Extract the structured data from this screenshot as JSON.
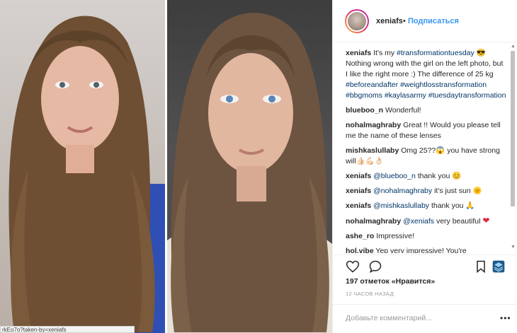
{
  "post": {
    "owner": "xeniafs",
    "dot": "•",
    "follow_label": "Подписаться"
  },
  "status_bar": {
    "text": "rkEo7o?taken-by=xeniafs"
  },
  "comments": [
    {
      "user": "xeniafs",
      "parts": [
        {
          "t": "It's my "
        },
        {
          "tag": "#transformationtuesday"
        },
        {
          "t": " 😎 Nothing wrong with the girl on the left photo, but I like the right more :) The difference of 25 kg "
        },
        {
          "tag": "#beforeandafter"
        },
        {
          "t": " "
        },
        {
          "tag": "#weightlosstransformation"
        },
        {
          "t": " "
        },
        {
          "tag": "#bbgmoms"
        },
        {
          "t": " "
        },
        {
          "tag": "#kaylasarmy"
        },
        {
          "t": " "
        },
        {
          "tag": "#tuesdaytransformation"
        }
      ]
    },
    {
      "user": "blueboo_n",
      "parts": [
        {
          "t": "Wonderful!"
        }
      ]
    },
    {
      "user": "nohalmaghraby",
      "parts": [
        {
          "t": "Great !! Would you please tell me the name of these lenses"
        }
      ]
    },
    {
      "user": "mishkaslullaby",
      "parts": [
        {
          "t": "Omg 25??😱 you have strong will👍🏻💪🏻👌🏻"
        }
      ]
    },
    {
      "user": "xeniafs",
      "parts": [
        {
          "tag": "@blueboo_n"
        },
        {
          "t": " thank you 😊"
        }
      ]
    },
    {
      "user": "xeniafs",
      "parts": [
        {
          "tag": "@nohalmaghraby"
        },
        {
          "t": " it's just sun 🌞"
        }
      ]
    },
    {
      "user": "xeniafs",
      "parts": [
        {
          "tag": "@mishkaslullaby"
        },
        {
          "t": " thank you 🙏"
        }
      ]
    },
    {
      "user": "nohalmaghraby",
      "parts": [
        {
          "tag": "@xeniafs"
        },
        {
          "t": " very beautiful "
        },
        {
          "heart": "❤"
        }
      ]
    },
    {
      "user": "ashe_ro",
      "parts": [
        {
          "t": "Impressive!"
        }
      ]
    },
    {
      "user": "hol.vibe",
      "parts": [
        {
          "t": "Yep very impressive! You're"
        }
      ]
    }
  ],
  "likes": {
    "text": "197 отметок «Нравится»"
  },
  "timestamp": "12 ЧАСОВ НАЗАД",
  "add_comment": {
    "placeholder": "Добавьте комментарий..."
  },
  "more_label": "•••",
  "icons": {
    "like": "heart-outline-icon",
    "comment": "comment-bubble-icon",
    "save": "bookmark-icon",
    "extension": "layers-extension-icon"
  },
  "colors": {
    "link": "#003569",
    "follow": "#3897f0",
    "text": "#262626",
    "muted": "#999999"
  }
}
